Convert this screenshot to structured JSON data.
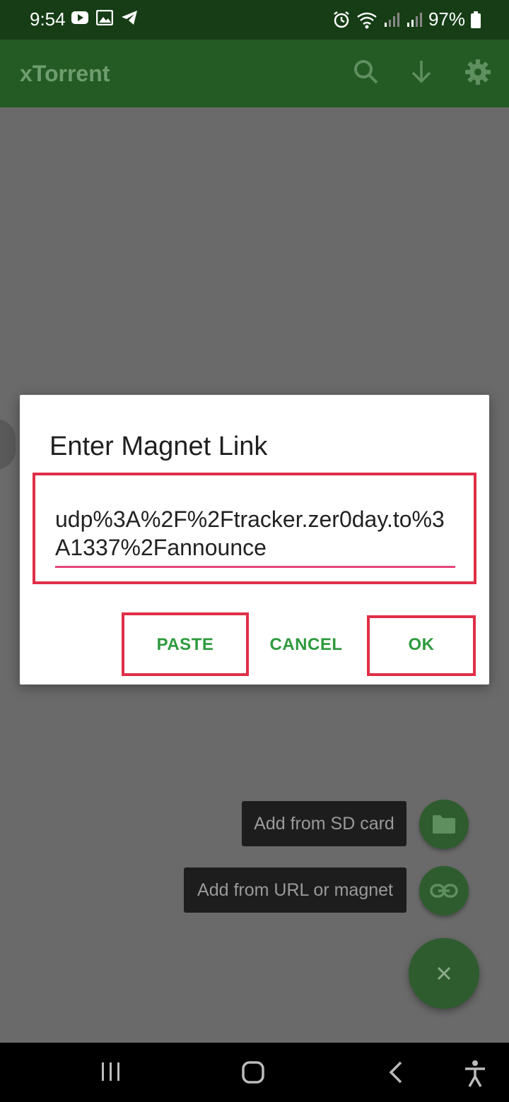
{
  "status_bar": {
    "time": "9:54",
    "battery": "97%"
  },
  "app_bar": {
    "title": "xTorrent"
  },
  "dialog": {
    "title": "Enter Magnet Link",
    "input_value": "udp%3A%2F%2Ftracker.zer0day.to%3A1337%2Fannounce",
    "buttons": {
      "paste": "PASTE",
      "cancel": "CANCEL",
      "ok": "OK"
    }
  },
  "fab_menu": {
    "sd_card_label": "Add from SD card",
    "url_label": "Add from URL or magnet"
  },
  "colors": {
    "status_bar": "#163d16",
    "app_bar": "#245b24",
    "accent_green": "#2e9a3e",
    "highlight_red": "#e02f47",
    "fab": "#2e5c2e"
  }
}
